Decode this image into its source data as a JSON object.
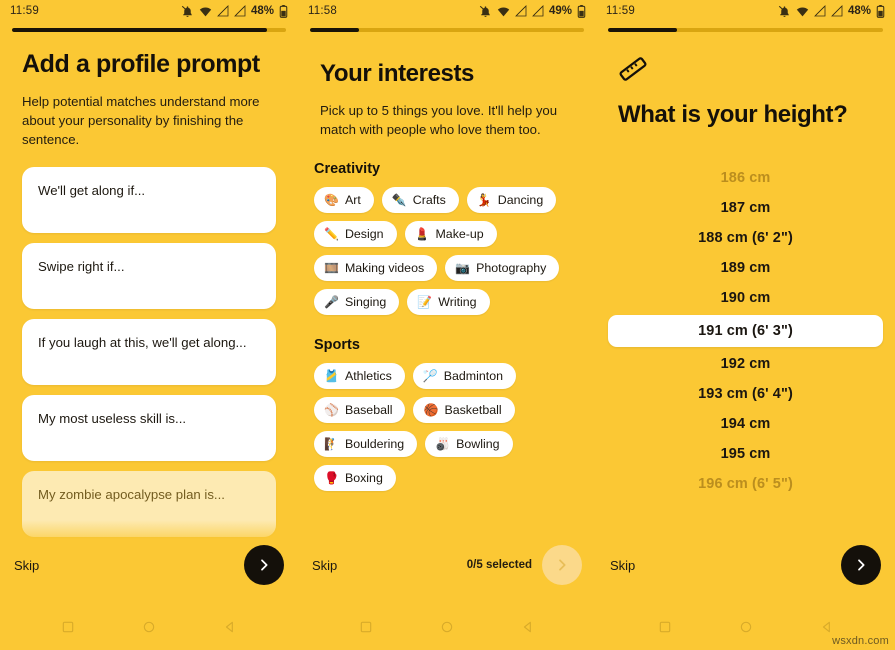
{
  "theme": {
    "background": "#FBC834",
    "ink": "#14100a",
    "card": "#ffffff",
    "progress_track": "#D9A511",
    "progress_fill": "#191307",
    "dim_text": "#bb8e1e",
    "fab_disabled": "#FBD98A"
  },
  "screens": [
    {
      "id": "add-profile-prompt",
      "statusbar": {
        "time": "11:59",
        "battery": "48%"
      },
      "progress_percent": 93,
      "title": "Add a profile prompt",
      "subtitle": "Help potential matches understand more about your personality by finishing the sentence.",
      "prompts": [
        "We'll get along if...",
        "Swipe right if...",
        "If you laugh at this, we'll get along...",
        "My most useless skill is...",
        "My zombie apocalypse plan is..."
      ],
      "skip_label": "Skip",
      "next_enabled": true
    },
    {
      "id": "your-interests",
      "statusbar": {
        "time": "11:58",
        "battery": "49%"
      },
      "progress_percent": 18,
      "title": "Your interests",
      "subtitle": "Pick up to 5 things you love. It'll help you match with people who love them too.",
      "sections": [
        {
          "name": "Creativity",
          "chips": [
            {
              "emoji": "🎨",
              "label": "Art",
              "icon": "palette-icon"
            },
            {
              "emoji": "✒️",
              "label": "Crafts",
              "icon": "pen-icon"
            },
            {
              "emoji": "💃",
              "label": "Dancing",
              "icon": "dancer-icon"
            },
            {
              "emoji": "✏️",
              "label": "Design",
              "icon": "pencil-icon"
            },
            {
              "emoji": "💄",
              "label": "Make-up",
              "icon": "lipstick-icon"
            },
            {
              "emoji": "🎞️",
              "label": "Making videos",
              "icon": "film-frames-icon"
            },
            {
              "emoji": "📷",
              "label": "Photography",
              "icon": "camera-icon"
            },
            {
              "emoji": "🎤",
              "label": "Singing",
              "icon": "microphone-icon"
            },
            {
              "emoji": "📝",
              "label": "Writing",
              "icon": "memo-icon"
            }
          ]
        },
        {
          "name": "Sports",
          "chips": [
            {
              "emoji": "🎽",
              "label": "Athletics",
              "icon": "running-shirt-icon"
            },
            {
              "emoji": "🏸",
              "label": "Badminton",
              "icon": "badminton-icon"
            },
            {
              "emoji": "⚾",
              "label": "Baseball",
              "icon": "baseball-icon"
            },
            {
              "emoji": "🏀",
              "label": "Basketball",
              "icon": "basketball-icon"
            },
            {
              "emoji": "🧗",
              "label": "Bouldering",
              "icon": "climbing-icon"
            },
            {
              "emoji": "🎳",
              "label": "Bowling",
              "icon": "bowling-icon"
            },
            {
              "emoji": "🥊",
              "label": "Boxing",
              "icon": "boxing-glove-icon"
            }
          ]
        }
      ],
      "skip_label": "Skip",
      "selected_count_label": "0/5 selected",
      "next_enabled": false
    },
    {
      "id": "what-is-your-height",
      "statusbar": {
        "time": "11:59",
        "battery": "48%"
      },
      "progress_percent": 25,
      "icon": "ruler-icon",
      "title": "What is your height?",
      "height_options": [
        {
          "label": "186 cm",
          "state": "dim"
        },
        {
          "label": "187 cm",
          "state": "normal"
        },
        {
          "label": "188 cm (6' 2\")",
          "state": "normal"
        },
        {
          "label": "189 cm",
          "state": "normal"
        },
        {
          "label": "190 cm",
          "state": "normal"
        },
        {
          "label": "191 cm (6' 3\")",
          "state": "selected"
        },
        {
          "label": "192 cm",
          "state": "normal"
        },
        {
          "label": "193 cm (6' 4\")",
          "state": "normal"
        },
        {
          "label": "194 cm",
          "state": "normal"
        },
        {
          "label": "195 cm",
          "state": "normal"
        },
        {
          "label": "196 cm (6' 5\")",
          "state": "dim"
        }
      ],
      "selected_height": "191 cm (6' 3\")",
      "skip_label": "Skip",
      "next_enabled": true
    }
  ],
  "navbar": {
    "recents": "square-icon",
    "home": "circle-icon",
    "back": "triangle-back-icon"
  },
  "watermark": "wsxdn.com"
}
